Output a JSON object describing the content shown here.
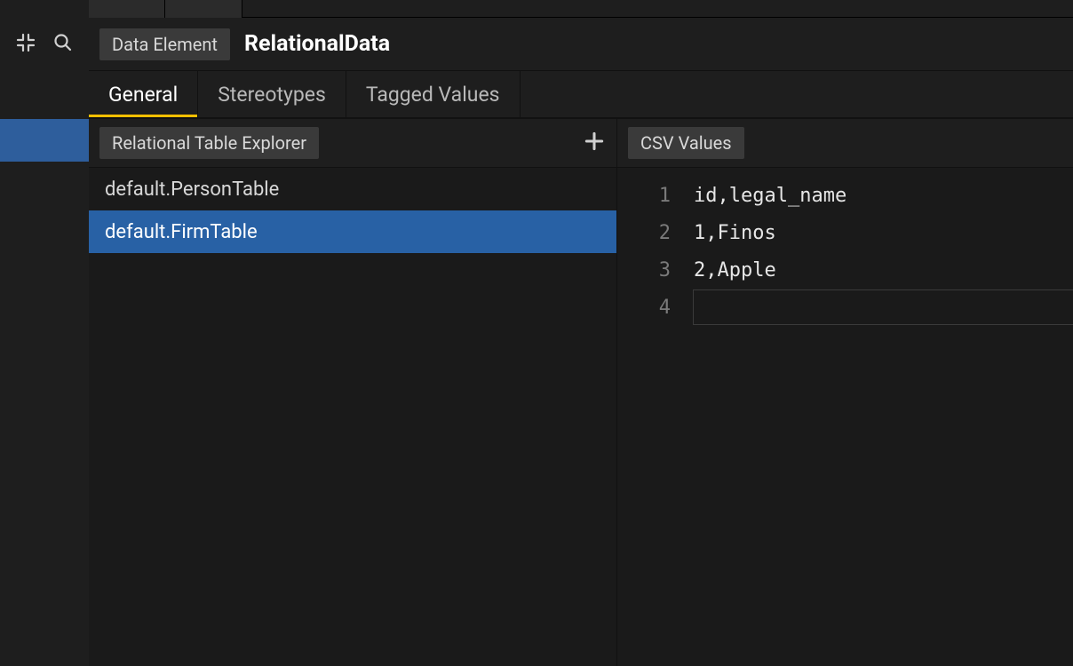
{
  "header": {
    "chip_label": "Data Element",
    "title": "RelationalData"
  },
  "section_tabs": {
    "items": [
      "General",
      "Stereotypes",
      "Tagged Values"
    ],
    "active_index": 0
  },
  "explorer": {
    "title": "Relational Table Explorer",
    "items": [
      {
        "label": "default.PersonTable",
        "selected": false
      },
      {
        "label": "default.FirmTable",
        "selected": true
      }
    ]
  },
  "csv": {
    "title": "CSV Values",
    "lines": [
      "id,legal_name",
      "1,Finos",
      "2,Apple",
      ""
    ],
    "cursor_line_index": 3
  }
}
